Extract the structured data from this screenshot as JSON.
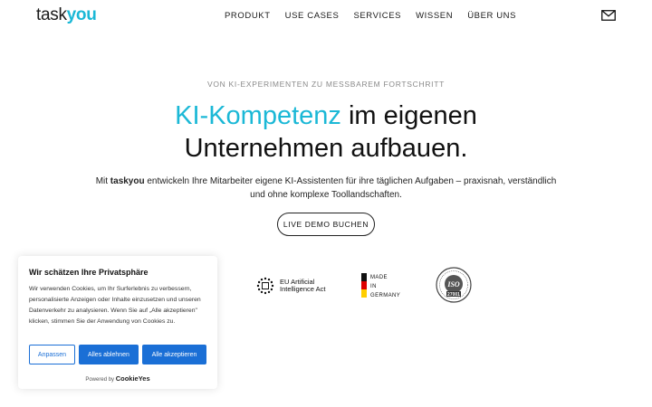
{
  "header": {
    "logo_part1": "task",
    "logo_part2": "you",
    "nav": [
      "PRODUKT",
      "USE CASES",
      "SERVICES",
      "WISSEN",
      "ÜBER UNS"
    ],
    "mail_icon": "mail-icon"
  },
  "hero": {
    "eyebrow": "VON KI-EXPERIMENTEN ZU MESSBAREM FORTSCHRITT",
    "headline_accent": "KI-Kompetenz",
    "headline_rest1": " im eigenen",
    "headline_line2": "Unternehmen aufbauen.",
    "sub_prefix": "Mit ",
    "sub_brand": "taskyou",
    "sub_rest": " entwickeln Ihre Mitarbeiter eigene KI-Assistenten für ihre täglichen Aufgaben – praxisnah, verständlich und ohne komplexe Toollandschaften.",
    "cta_label": "LIVE DEMO BUCHEN",
    "accent_color": "#1bb8d6"
  },
  "badges": {
    "eu_line1": "EU Artificial",
    "eu_line2": "Intelligence Act",
    "ger_line1": "MADE",
    "ger_line2": "IN",
    "ger_line3": "GERMANY",
    "iso_text": "ISO",
    "iso_num": "27001"
  },
  "cookie": {
    "title": "Wir schätzen Ihre Privatsphäre",
    "text": "Wir verwenden Cookies, um Ihr Surferlebnis zu verbessern, personalisierte Anzeigen oder Inhalte einzusetzen und unseren Datenverkehr zu analysieren. Wenn Sie auf „Alle akzeptieren\" klicken, stimmen Sie der Anwendung von Cookies zu.",
    "btn_customize": "Anpassen",
    "btn_reject": "Alles ablehnen",
    "btn_accept": "Alle akzeptieren",
    "powered_by": "Powered by",
    "powered_brand": "CookieYes",
    "button_color": "#1a6fd6"
  }
}
